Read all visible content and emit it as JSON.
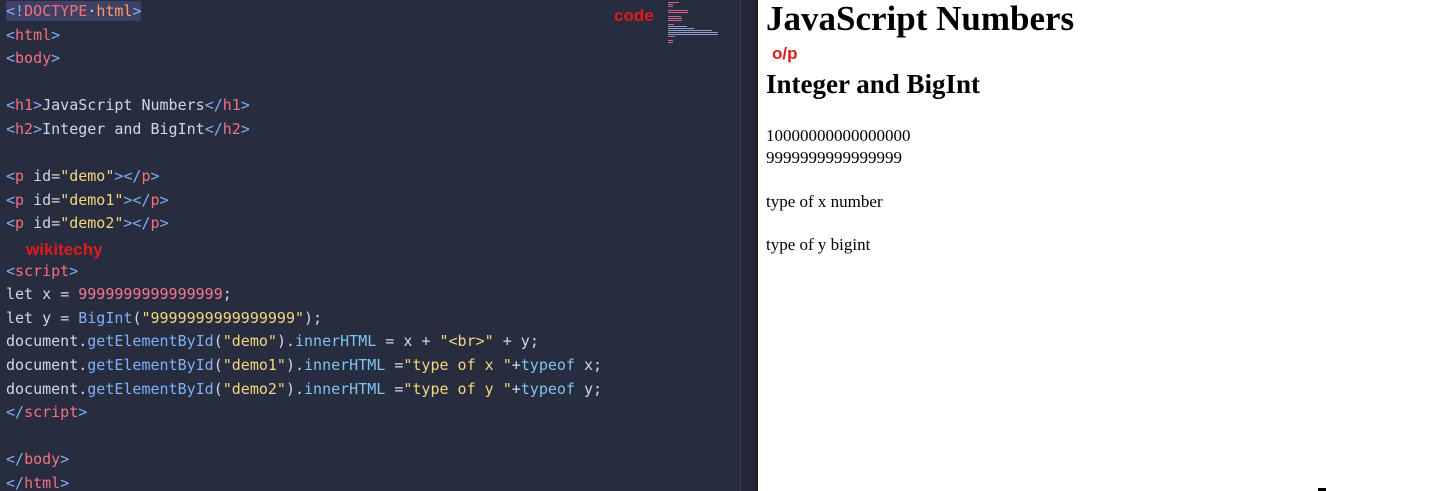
{
  "editor": {
    "annotation_code": "code",
    "annotation_wikitechy": "wikitechy",
    "lines": [
      [
        [
          "t-br doctype-hl",
          "<!"
        ],
        [
          "t-doc doctype-hl",
          "DOCTYPE"
        ],
        [
          "t-pun doctype-hl",
          "·"
        ],
        [
          "t-kw doctype-hl",
          "html"
        ],
        [
          "t-br doctype-hl",
          ">"
        ]
      ],
      [
        [
          "t-br",
          "<"
        ],
        [
          "t-tag",
          "html"
        ],
        [
          "t-br",
          ">"
        ]
      ],
      [
        [
          "t-br",
          "<"
        ],
        [
          "t-tag",
          "body"
        ],
        [
          "t-br",
          ">"
        ]
      ],
      [],
      [
        [
          "t-br",
          "<"
        ],
        [
          "t-tag",
          "h1"
        ],
        [
          "t-br",
          ">"
        ],
        [
          "t-id",
          "JavaScript Numbers"
        ],
        [
          "t-br",
          "</"
        ],
        [
          "t-tag",
          "h1"
        ],
        [
          "t-br",
          ">"
        ]
      ],
      [
        [
          "t-br",
          "<"
        ],
        [
          "t-tag",
          "h2"
        ],
        [
          "t-br",
          ">"
        ],
        [
          "t-id",
          "Integer and BigInt"
        ],
        [
          "t-br",
          "</"
        ],
        [
          "t-tag",
          "h2"
        ],
        [
          "t-br",
          ">"
        ]
      ],
      [],
      [
        [
          "t-br",
          "<"
        ],
        [
          "t-tag",
          "p"
        ],
        [
          "t-attr",
          " id"
        ],
        [
          "t-op",
          "="
        ],
        [
          "t-str",
          "\"demo\""
        ],
        [
          "t-br",
          "></"
        ],
        [
          "t-tag",
          "p"
        ],
        [
          "t-br",
          ">"
        ]
      ],
      [
        [
          "t-br",
          "<"
        ],
        [
          "t-tag",
          "p"
        ],
        [
          "t-attr",
          " id"
        ],
        [
          "t-op",
          "="
        ],
        [
          "t-str",
          "\"demo1\""
        ],
        [
          "t-br",
          "></"
        ],
        [
          "t-tag",
          "p"
        ],
        [
          "t-br",
          ">"
        ]
      ],
      [
        [
          "t-br",
          "<"
        ],
        [
          "t-tag",
          "p"
        ],
        [
          "t-attr",
          " id"
        ],
        [
          "t-op",
          "="
        ],
        [
          "t-str",
          "\"demo2\""
        ],
        [
          "t-br",
          "></"
        ],
        [
          "t-tag",
          "p"
        ],
        [
          "t-br",
          ">"
        ]
      ],
      [],
      [
        [
          "t-br",
          "<"
        ],
        [
          "t-tag",
          "script"
        ],
        [
          "t-br",
          ">"
        ]
      ],
      [
        [
          "t-id",
          "let x "
        ],
        [
          "t-op",
          "= "
        ],
        [
          "t-num",
          "9999999999999999"
        ],
        [
          "t-pun",
          ";"
        ]
      ],
      [
        [
          "t-id",
          "let y "
        ],
        [
          "t-op",
          "= "
        ],
        [
          "t-fn",
          "BigInt"
        ],
        [
          "t-pun",
          "("
        ],
        [
          "t-str",
          "\"9999999999999999\""
        ],
        [
          "t-pun",
          ");"
        ]
      ],
      [
        [
          "t-id",
          "document."
        ],
        [
          "t-fn",
          "getElementById"
        ],
        [
          "t-pun",
          "("
        ],
        [
          "t-str",
          "\"demo\""
        ],
        [
          "t-pun",
          ")."
        ],
        [
          "t-prop",
          "innerHTML"
        ],
        [
          "t-op",
          " = "
        ],
        [
          "t-id",
          "x "
        ],
        [
          "t-op",
          "+ "
        ],
        [
          "t-str",
          "\"<br>\""
        ],
        [
          "t-op",
          " + "
        ],
        [
          "t-id",
          "y"
        ],
        [
          "t-pun",
          ";"
        ]
      ],
      [
        [
          "t-id",
          "document."
        ],
        [
          "t-fn",
          "getElementById"
        ],
        [
          "t-pun",
          "("
        ],
        [
          "t-str",
          "\"demo1\""
        ],
        [
          "t-pun",
          ")."
        ],
        [
          "t-prop",
          "innerHTML"
        ],
        [
          "t-op",
          " ="
        ],
        [
          "t-str",
          "\"type of x \""
        ],
        [
          "t-op",
          "+"
        ],
        [
          "t-prop",
          "typeof"
        ],
        [
          "t-id",
          " x"
        ],
        [
          "t-pun",
          ";"
        ]
      ],
      [
        [
          "t-id",
          "document."
        ],
        [
          "t-fn",
          "getElementById"
        ],
        [
          "t-pun",
          "("
        ],
        [
          "t-str",
          "\"demo2\""
        ],
        [
          "t-pun",
          ")."
        ],
        [
          "t-prop",
          "innerHTML"
        ],
        [
          "t-op",
          " ="
        ],
        [
          "t-str",
          "\"type of y \""
        ],
        [
          "t-op",
          "+"
        ],
        [
          "t-prop",
          "typeof"
        ],
        [
          "t-id",
          " y"
        ],
        [
          "t-pun",
          ";"
        ]
      ],
      [
        [
          "t-br",
          "</"
        ],
        [
          "t-tag",
          "script"
        ],
        [
          "t-br",
          ">"
        ]
      ],
      [],
      [
        [
          "t-br",
          "</"
        ],
        [
          "t-tag",
          "body"
        ],
        [
          "t-br",
          ">"
        ]
      ],
      [
        [
          "t-br",
          "</"
        ],
        [
          "t-tag",
          "html"
        ],
        [
          "t-br",
          ">"
        ]
      ]
    ]
  },
  "output": {
    "h1": "JavaScript Numbers",
    "annotation_op": "o/p",
    "h2": "Integer and BigInt",
    "demo_line1": "10000000000000000",
    "demo_line2": "9999999999999999",
    "demo1": "type of x number",
    "demo2": "type of y bigint"
  },
  "colors": {
    "editor_bg": "#282c3f",
    "annotation_red": "#e11b1b"
  }
}
